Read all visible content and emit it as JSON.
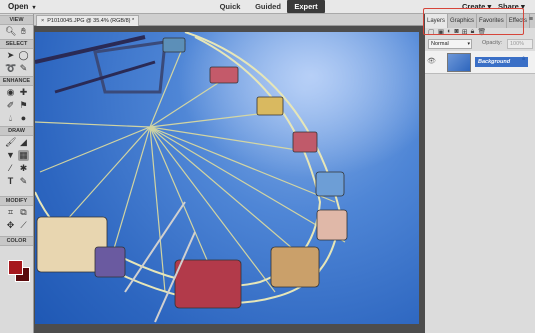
{
  "topbar": {
    "open_label": "Open",
    "modes": [
      "Quick",
      "Guided",
      "Expert"
    ],
    "active_mode": "Expert",
    "create_label": "Create",
    "share_label": "Share"
  },
  "toolbox": {
    "sections": [
      "VIEW",
      "SELECT",
      "ENHANCE",
      "DRAW",
      "MODIFY",
      "COLOR"
    ],
    "colors": {
      "foreground": "#a6181d",
      "background": "#5a0a0c"
    }
  },
  "document": {
    "tab_label": "P1010045.JPG @ 35.4% (RGB/8) *"
  },
  "panel": {
    "tabs": [
      "Layers",
      "Graphics",
      "Favorites",
      "Effects"
    ],
    "active_tab": "Layers",
    "blend_mode": "Normal",
    "opacity_label": "Opacity:",
    "opacity_value": "100%",
    "layer_name": "Background"
  },
  "colors": {
    "highlight": "#d6453a",
    "accent": "#3a6fc6"
  }
}
